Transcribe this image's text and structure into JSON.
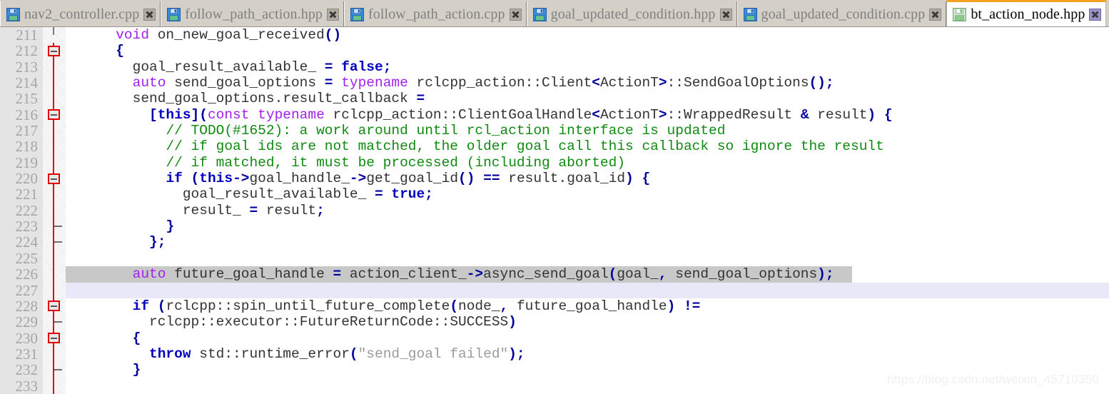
{
  "tabs": [
    {
      "label": "nav2_controller.cpp",
      "icon": "floppy-save-icon",
      "active": false,
      "close_icon": "close-icon"
    },
    {
      "label": "follow_path_action.hpp",
      "icon": "floppy-save-icon",
      "active": false,
      "close_icon": "close-icon"
    },
    {
      "label": "follow_path_action.cpp",
      "icon": "floppy-save-icon",
      "active": false,
      "close_icon": "close-icon"
    },
    {
      "label": "goal_updated_condition.hpp",
      "icon": "floppy-save-icon",
      "active": false,
      "close_icon": "close-icon"
    },
    {
      "label": "goal_updated_condition.cpp",
      "icon": "floppy-save-icon",
      "active": false,
      "close_icon": "close-icon"
    },
    {
      "label": "bt_action_node.hpp",
      "icon": "floppy-save-icon",
      "active": true,
      "close_icon": "close-icon"
    }
  ],
  "editor": {
    "accent_color": "#f5a220",
    "current_line_color": "#e8e8f8",
    "selection_band_color": "#c8c8c8",
    "gutter_bg": "#e4e4e4",
    "gutter_fg": "#a6a6a6",
    "fold_line_color": "#e00000",
    "first_line": 211,
    "lines": [
      {
        "n": "211",
        "fold": "gray-half-bot",
        "text": "      void on_new_goal_received()"
      },
      {
        "n": "212",
        "fold": "box",
        "text": "      {"
      },
      {
        "n": "213",
        "fold": "line",
        "text": "        goal_result_available_ = false;"
      },
      {
        "n": "214",
        "fold": "line",
        "text": "        auto send_goal_options = typename rclcpp_action::Client<ActionT>::SendGoalOptions();"
      },
      {
        "n": "215",
        "fold": "line",
        "text": "        send_goal_options.result_callback ="
      },
      {
        "n": "216",
        "fold": "box",
        "text": "          [this](const typename rclcpp_action::ClientGoalHandle<ActionT>::WrappedResult & result) {"
      },
      {
        "n": "217",
        "fold": "line",
        "text": "            // TODO(#1652): a work around until rcl_action interface is updated"
      },
      {
        "n": "218",
        "fold": "line",
        "text": "            // if goal ids are not matched, the older goal call this callback so ignore the result"
      },
      {
        "n": "219",
        "fold": "line",
        "text": "            // if matched, it must be processed (including aborted)"
      },
      {
        "n": "220",
        "fold": "box",
        "text": "            if (this->goal_handle_->get_goal_id() == result.goal_id) {"
      },
      {
        "n": "221",
        "fold": "line",
        "text": "              goal_result_available_ = true;"
      },
      {
        "n": "222",
        "fold": "line",
        "text": "              result_ = result;"
      },
      {
        "n": "223",
        "fold": "tick",
        "text": "            }"
      },
      {
        "n": "224",
        "fold": "tick",
        "text": "          };"
      },
      {
        "n": "225",
        "fold": "line",
        "text": ""
      },
      {
        "n": "226",
        "fold": "line",
        "text": "        auto future_goal_handle = action_client_->async_send_goal(goal_, send_goal_options);",
        "highlight": "band"
      },
      {
        "n": "227",
        "fold": "line",
        "text": "",
        "highlight": "current"
      },
      {
        "n": "228",
        "fold": "box",
        "text": "        if (rclcpp::spin_until_future_complete(node_, future_goal_handle) !="
      },
      {
        "n": "229",
        "fold": "tick",
        "text": "          rclcpp::executor::FutureReturnCode::SUCCESS)"
      },
      {
        "n": "230",
        "fold": "box",
        "text": "        {"
      },
      {
        "n": "231",
        "fold": "line",
        "text": "          throw std::runtime_error(\"send_goal failed\");"
      },
      {
        "n": "232",
        "fold": "tick",
        "text": "        }"
      },
      {
        "n": "233",
        "fold": "line",
        "text": ""
      }
    ]
  },
  "watermark": {
    "text": "https://blog.csdn.net/weixin_45710350"
  }
}
